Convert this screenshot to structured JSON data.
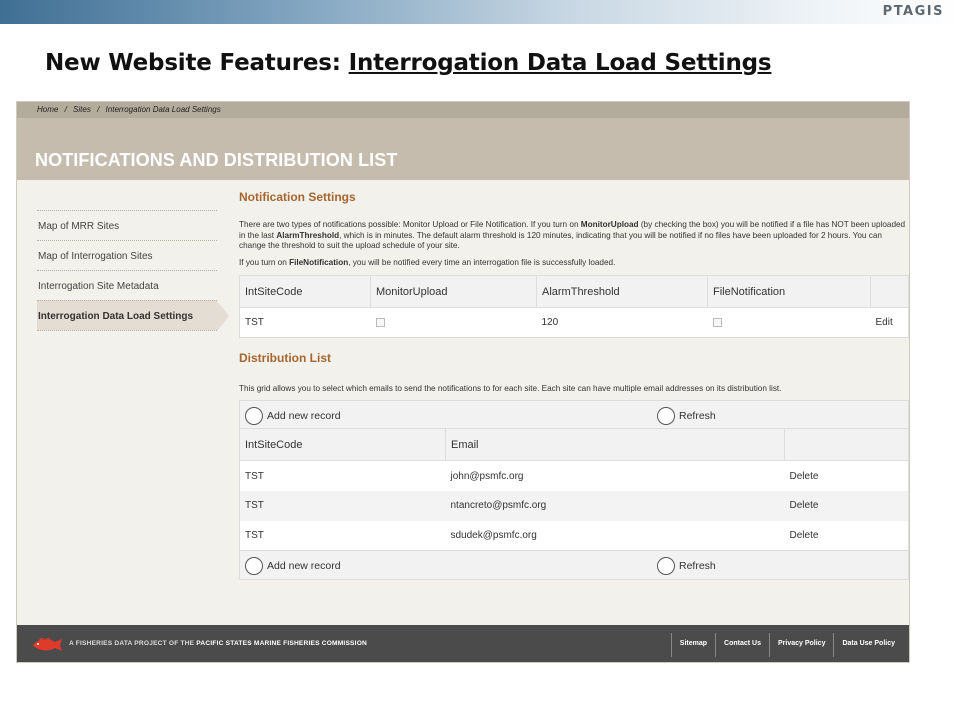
{
  "slide": {
    "logo": "PTAGIS",
    "title_prefix": "New Website Features: ",
    "title_underlined": "Interrogation Data Load Settings"
  },
  "breadcrumb": [
    "Home",
    "/",
    "Sites",
    "/",
    "Interrogation Data Load Settings"
  ],
  "page_header": "NOTIFICATIONS AND DISTRIBUTION LIST",
  "sidebar": {
    "items": [
      {
        "label": "Map of MRR Sites",
        "active": false
      },
      {
        "label": "Map of Interrogation Sites",
        "active": false
      },
      {
        "label": "Interrogation Site Metadata",
        "active": false
      },
      {
        "label": "Interrogation Data Load Settings",
        "active": true
      }
    ]
  },
  "notification_settings": {
    "heading": "Notification Settings",
    "para1_a": "There are two types of notifications possible: Monitor Upload or File Notification. If you turn on ",
    "para1_b": "MonitorUpload",
    "para1_c": " (by checking the box) you will be notified if a file has NOT been uploaded in the last ",
    "para1_d": "AlarmThreshold",
    "para1_e": ", which is in minutes. The default alarm threshold is 120 minutes, indicating that you will be notified if no files have been uploaded for 2 hours. You can change the threshold to suit the upload schedule of your site.",
    "para2_a": "If you turn on ",
    "para2_b": "FileNotification",
    "para2_c": ", you will be notified every time an interrogation file is successfully loaded.",
    "columns": [
      "IntSiteCode",
      "MonitorUpload",
      "AlarmThreshold",
      "FileNotification"
    ],
    "rows": [
      {
        "site": "TST",
        "monitor_upload": false,
        "alarm_threshold": "120",
        "file_notification": false,
        "action": "Edit"
      }
    ]
  },
  "distribution_list": {
    "heading": "Distribution List",
    "description": "This grid allows you to select which emails to send the notifications to for each site. Each site can have multiple email addresses on its distribution list.",
    "add_label": "Add new record",
    "refresh_label": "Refresh",
    "columns": [
      "IntSiteCode",
      "Email"
    ],
    "rows": [
      {
        "site": "TST",
        "email": "john@psmfc.org",
        "action": "Delete"
      },
      {
        "site": "TST",
        "email": "ntancreto@psmfc.org",
        "action": "Delete"
      },
      {
        "site": "TST",
        "email": "sdudek@psmfc.org",
        "action": "Delete"
      }
    ]
  },
  "footer": {
    "text_a": "A FISHERIES DATA PROJECT OF THE ",
    "text_b": "PACIFIC STATES MARINE FISHERIES COMMISSION",
    "links": [
      "Sitemap",
      "Contact Us",
      "Privacy Policy",
      "Data Use Policy"
    ]
  },
  "colors": {
    "section_heading": "#a7662f",
    "header_band": "#c5bcae",
    "footer": "#4b4b4b",
    "fish": "#e03a2a"
  }
}
